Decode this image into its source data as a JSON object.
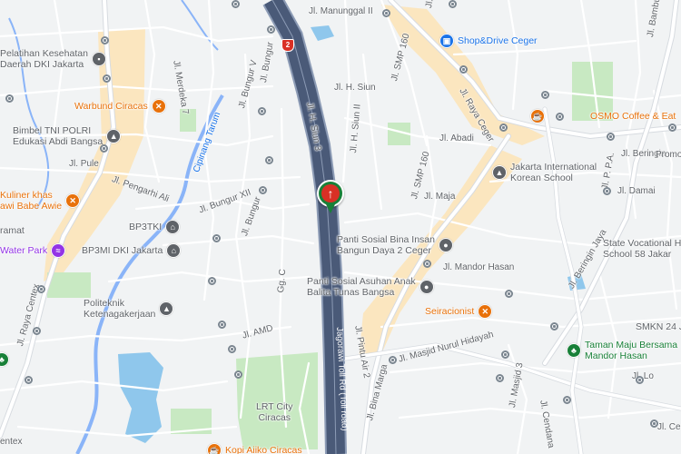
{
  "map": {
    "colors": {
      "background": "#f1f3f4",
      "road": "#ffffff",
      "road_outline": "#d7dbe0",
      "toll_road": "#4a5a78",
      "toll_outline": "#8c9bb5",
      "highlight": "#fbe6bf",
      "park": "#c8e9c2",
      "water": "#8fc7ec",
      "waterway": "#8ab4f8",
      "poi_gray": "#5f6368",
      "poi_orange": "#e8710a",
      "poi_blue": "#1a73e8",
      "poi_green": "#188038",
      "poi_purple": "#9334e6",
      "marker_green": "#188038",
      "marker_red": "#d93025"
    },
    "highway_shield": "2",
    "marker": {
      "icon": "arrow-up-icon",
      "glyph": "↑"
    },
    "streets": [
      "Jl. Manunggal II",
      "Jl. SMP 160",
      "Jl. Raya Ceger",
      "Jl. H. Siun",
      "Jl. H. Siun 3",
      "Jl. H. Siun II",
      "Jl. Abadi",
      "Jl. SMP 160",
      "Jl. Maja",
      "Jl. Mandor Hasan",
      "Jl. Beringin Jaya",
      "Jl. Beringin",
      "Jl. Damai",
      "Jl. P. P.A.",
      "Jl. Bungur",
      "Jl. Bungur V",
      "Jl. Merdeka 7",
      "Jl. Bungur XII",
      "Jl. Bungur",
      "Jl. Pengarhi Ali",
      "Jl. Pule",
      "Jl. Raya Centex",
      "Jl. AMD",
      "Jl. Masjid Nurul Hidayah",
      "Jl. Bina Marga",
      "Jl. Masjid 3",
      "Jl. Pintu Air 2",
      "Jl. Cendana",
      "Jl. Bambu Ku",
      "Gg. C",
      "Cipinang Tarum",
      "Jagorawi Toll Rd (Toll road)",
      "Jl. Lo",
      "Jl. Cenda",
      "Promo",
      "Jl. H.",
      "entex"
    ],
    "pois": [
      {
        "name": "Pelatihan Kesehatan\nDaerah DKI Jakarta",
        "icon": "building-icon",
        "kind": "gray"
      },
      {
        "name": "Warbund Ciracas",
        "icon": "restaurant-icon",
        "kind": "orange"
      },
      {
        "name": "Bimbel TNI POLRI\nEdukasi Abdi Bangsa",
        "icon": "school-icon",
        "kind": "gray"
      },
      {
        "name": "Kuliner khas\nawi Babe Awie",
        "icon": "restaurant-icon",
        "kind": "orange"
      },
      {
        "name": "ramat",
        "icon": "",
        "kind": "gray"
      },
      {
        "name": "Water Park",
        "icon": "water-park-icon",
        "kind": "purple"
      },
      {
        "name": "BP3TKI",
        "icon": "government-icon",
        "kind": "gray"
      },
      {
        "name": "BP3MI DKI Jakarta",
        "icon": "government-icon",
        "kind": "gray"
      },
      {
        "name": "Politeknik\nKetenagakerjaan",
        "icon": "school-icon",
        "kind": "gray"
      },
      {
        "name": "Shop&Drive Ceger",
        "icon": "shop-icon",
        "kind": "blue"
      },
      {
        "name": "OSMO Coffee & Eat",
        "icon": "cafe-icon",
        "kind": "orange"
      },
      {
        "name": "Jakarta International\nKorean School",
        "icon": "school-icon",
        "kind": "gray"
      },
      {
        "name": "Panti Sosial Bina Insan\nBangun Daya 2 Ceger",
        "icon": "place-icon",
        "kind": "gray"
      },
      {
        "name": "State Vocational Hi\nSchool 58 Jakar",
        "icon": "",
        "kind": "gray"
      },
      {
        "name": "Panti Sosial Asuhan Anak\nBalita Tunas Bangsa",
        "icon": "place-icon",
        "kind": "gray"
      },
      {
        "name": "Seiracionist",
        "icon": "restaurant-icon",
        "kind": "orange"
      },
      {
        "name": "SMKN 24 J",
        "icon": "",
        "kind": "gray"
      },
      {
        "name": "Taman Maju Bersama\nMandor Hasan",
        "icon": "park-icon",
        "kind": "green"
      },
      {
        "name": "LRT City\nCiracas",
        "icon": "",
        "kind": "gray"
      },
      {
        "name": "Kopi Aiiko Ciracas",
        "icon": "cafe-icon",
        "kind": "orange"
      }
    ]
  }
}
